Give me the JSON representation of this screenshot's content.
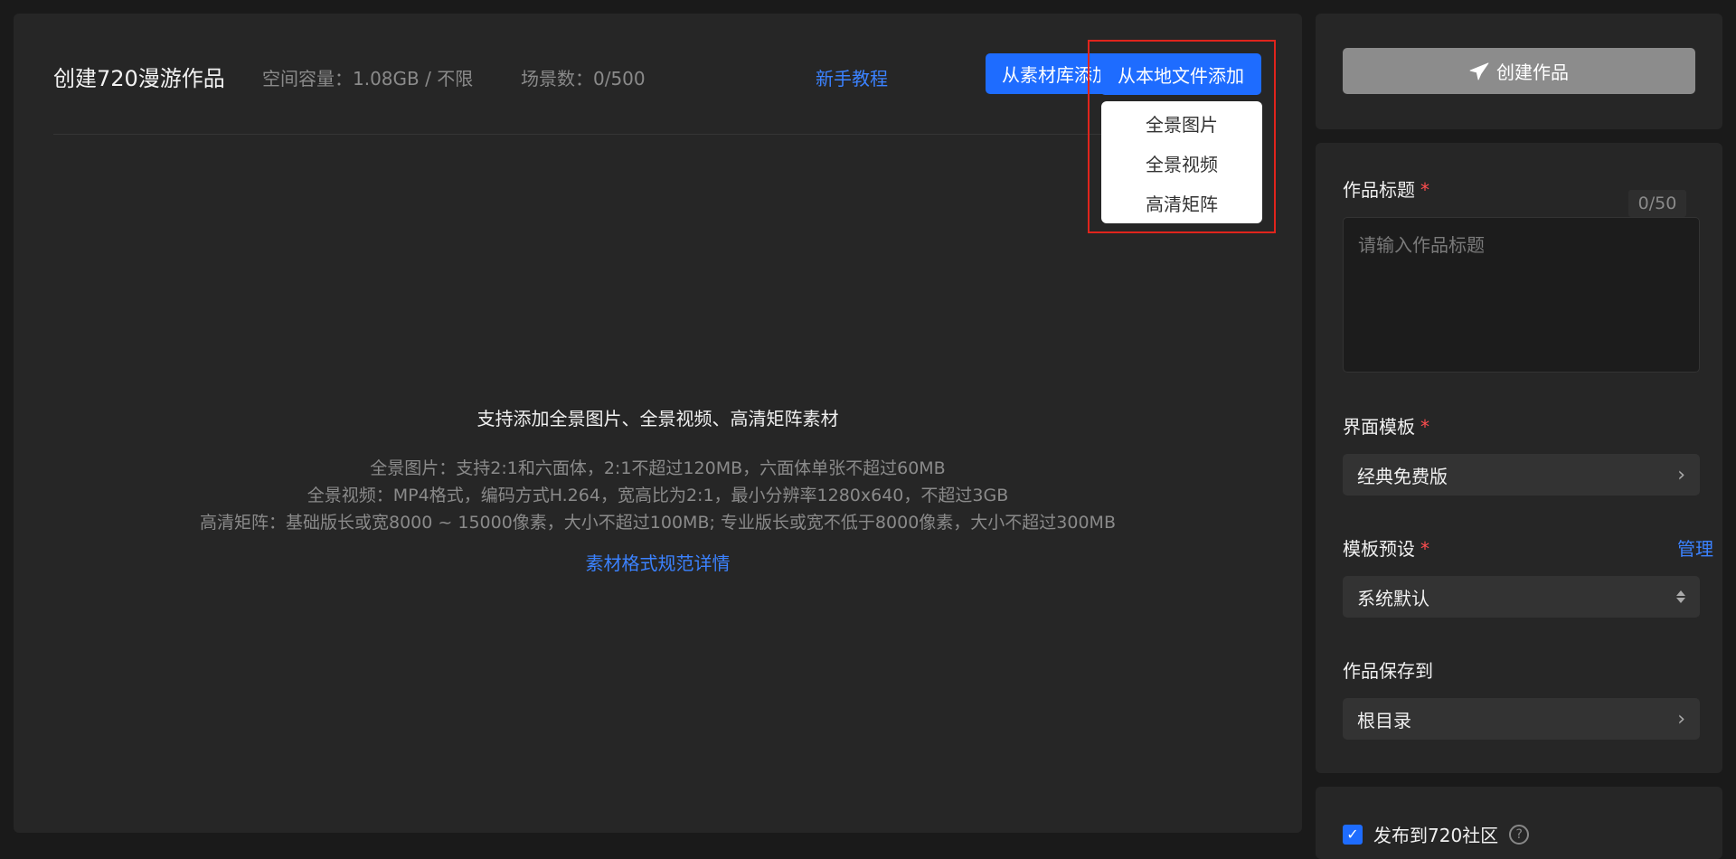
{
  "header": {
    "title": "创建720漫游作品",
    "storage": "空间容量：1.08GB / 不限",
    "scene_count": "场景数：0/500",
    "tutorial_link": "新手教程",
    "add_from_library": "从素材库添加",
    "add_from_local": "从本地文件添加"
  },
  "dropdown": {
    "items": [
      "全景图片",
      "全景视频",
      "高清矩阵"
    ]
  },
  "empty_state": {
    "title": "支持添加全景图片、全景视频、高清矩阵素材",
    "lines": [
      "全景图片：支持2:1和六面体，2:1不超过120MB，六面体单张不超过60MB",
      "全景视频：MP4格式，编码方式H.264，宽高比为2:1，最小分辨率1280x640，不超过3GB",
      "高清矩阵：基础版长或宽8000 ~ 15000像素，大小不超过100MB; 专业版长或宽不低于8000像素，大小不超过300MB"
    ],
    "link": "素材格式规范详情"
  },
  "sidebar": {
    "create_button": "创建作品",
    "title_label": "作品标题",
    "title_placeholder": "请输入作品标题",
    "title_count": "0/50",
    "template_label": "界面模板",
    "template_value": "经典免费版",
    "preset_label": "模板预设",
    "preset_manage": "管理",
    "preset_value": "系统默认",
    "save_to_label": "作品保存到",
    "save_to_value": "根目录",
    "publish_label": "发布到720社区",
    "required_mark": "*"
  },
  "colors": {
    "accent": "#1e6cff",
    "link": "#3b82ff",
    "highlight": "#e0241c",
    "required": "#ff4d4f"
  }
}
